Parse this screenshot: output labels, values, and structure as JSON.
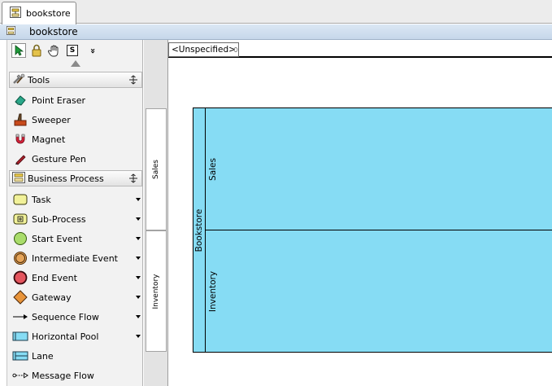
{
  "tab": {
    "title": "bookstore",
    "icon": "diagram-icon"
  },
  "diagram": {
    "title": "bookstore",
    "icon": "diagram-icon"
  },
  "toolbar": {
    "tools": [
      {
        "name": "select-arrow-icon"
      },
      {
        "name": "lock-icon"
      },
      {
        "name": "hand-icon"
      },
      {
        "name": "stamp-icon",
        "label": "S"
      },
      {
        "name": "more-chevron-icon",
        "label": "»"
      }
    ]
  },
  "palette": {
    "tools_group": {
      "label": "Tools",
      "items": [
        {
          "label": "Point Eraser",
          "icon": "eraser-icon"
        },
        {
          "label": "Sweeper",
          "icon": "sweeper-icon"
        },
        {
          "label": "Magnet",
          "icon": "magnet-icon"
        },
        {
          "label": "Gesture Pen",
          "icon": "pen-icon"
        }
      ]
    },
    "bp_group": {
      "label": "Business Process",
      "items": [
        {
          "label": "Task",
          "icon": "task-icon",
          "dropdown": true
        },
        {
          "label": "Sub-Process",
          "icon": "subprocess-icon",
          "dropdown": true
        },
        {
          "label": "Start Event",
          "icon": "start-event-icon",
          "dropdown": true
        },
        {
          "label": "Intermediate Event",
          "icon": "intermediate-event-icon",
          "dropdown": true
        },
        {
          "label": "End Event",
          "icon": "end-event-icon",
          "dropdown": true
        },
        {
          "label": "Gateway",
          "icon": "gateway-icon",
          "dropdown": true
        },
        {
          "label": "Sequence Flow",
          "icon": "sequence-flow-icon",
          "dropdown": true
        },
        {
          "label": "Horizontal Pool",
          "icon": "horizontal-pool-icon",
          "dropdown": true
        },
        {
          "label": "Lane",
          "icon": "lane-icon",
          "dropdown": false
        },
        {
          "label": "Message Flow",
          "icon": "message-flow-icon",
          "dropdown": false
        }
      ]
    }
  },
  "lane_headers": [
    {
      "label": "Sales"
    },
    {
      "label": "Inventory"
    }
  ],
  "canvas": {
    "unspecified_label": "<Unspecified>",
    "pool": {
      "label": "Bookstore",
      "color": "#86dcf4",
      "lanes": [
        {
          "label": "Sales"
        },
        {
          "label": "Inventory"
        }
      ]
    }
  }
}
